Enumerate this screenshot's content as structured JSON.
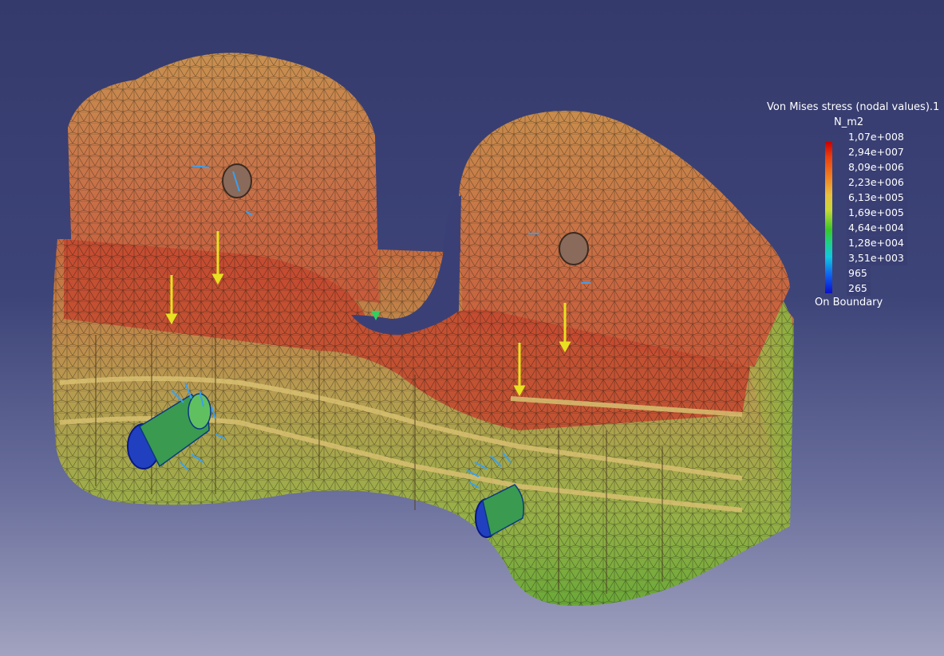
{
  "legend": {
    "title": "Von Mises stress (nodal values).1",
    "unit": "N_m2",
    "values": [
      "1,07e+008",
      "2,94e+007",
      "8,09e+006",
      "2,23e+006",
      "6,13e+005",
      "1,69e+005",
      "4,64e+004",
      "1,28e+004",
      "3,51e+003",
      "965",
      "265"
    ],
    "footer": "On Boundary"
  },
  "colors": {
    "background_top": "#353a6c",
    "background_bottom": "#a2a3c0",
    "stress_high": "#cc0000",
    "stress_mid": "#e8c040",
    "stress_low": "#0a10c8",
    "load_arrow": "#e8e020",
    "restraint_arrow": "#3aa0f0"
  },
  "viewport": {
    "model": "meshed-bracket-part",
    "icons": [
      "distributed-force-arrow-icon",
      "clamp-restraint-icon"
    ]
  }
}
